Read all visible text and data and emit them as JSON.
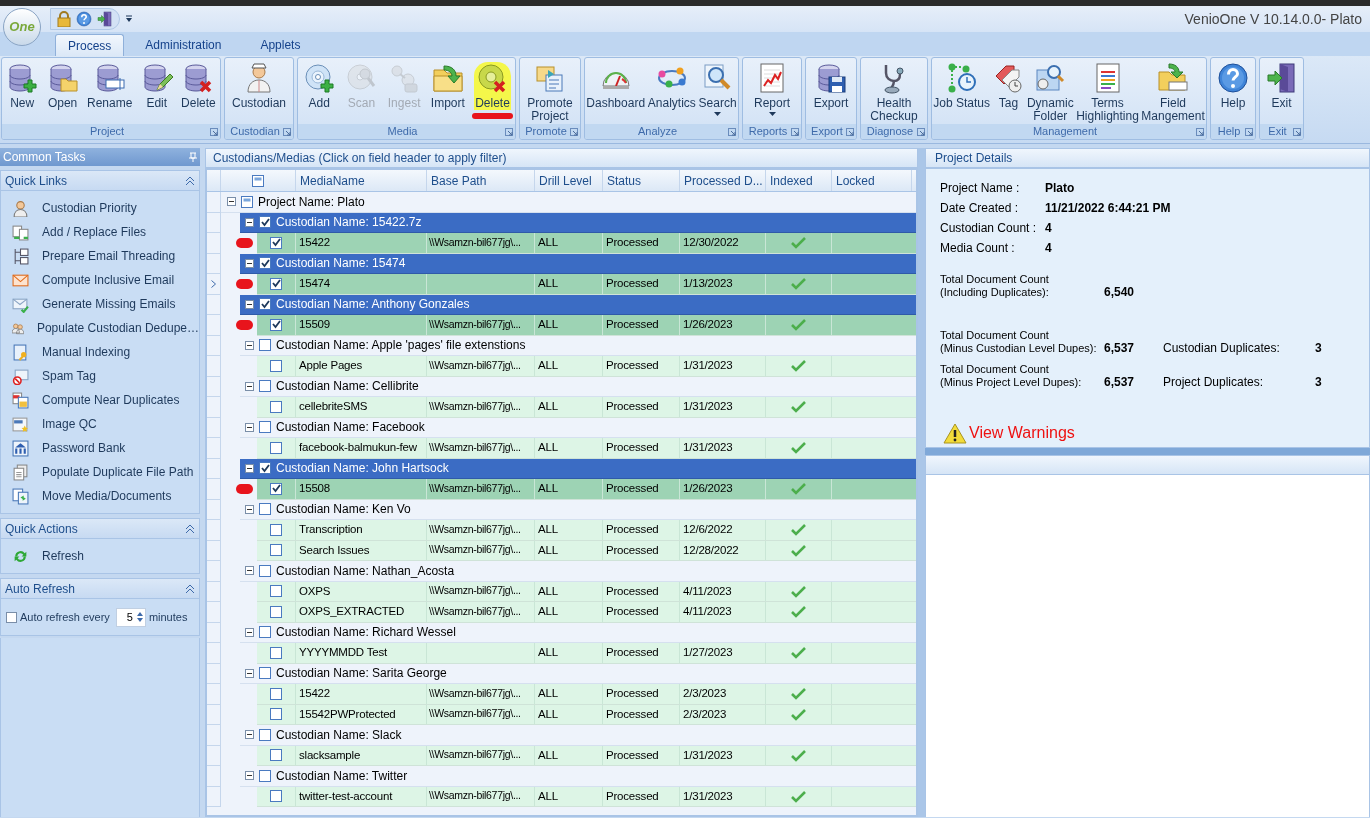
{
  "app": {
    "logo_text": "One",
    "title": "VenioOne V 10.14.0.0- Plato"
  },
  "tabs": [
    {
      "label": "Process",
      "selected": true
    },
    {
      "label": "Administration",
      "selected": false
    },
    {
      "label": "Applets",
      "selected": false
    }
  ],
  "ribbon": [
    {
      "caption": "Project",
      "buttons": [
        {
          "label": "New",
          "disabled": false,
          "dropdown": false,
          "highlighted": false
        },
        {
          "label": "Open",
          "disabled": false,
          "dropdown": false,
          "highlighted": false
        },
        {
          "label": "Rename",
          "disabled": false,
          "dropdown": false,
          "highlighted": false
        },
        {
          "label": "Edit",
          "disabled": false,
          "dropdown": false,
          "highlighted": false
        },
        {
          "label": "Delete",
          "disabled": false,
          "dropdown": false,
          "highlighted": false
        }
      ]
    },
    {
      "caption": "Custodian",
      "buttons": [
        {
          "label": "Custodian",
          "disabled": false,
          "dropdown": false,
          "highlighted": false
        }
      ]
    },
    {
      "caption": "Media",
      "buttons": [
        {
          "label": "Add",
          "disabled": false,
          "dropdown": false,
          "highlighted": false
        },
        {
          "label": "Scan",
          "disabled": true,
          "dropdown": false,
          "highlighted": false
        },
        {
          "label": "Ingest",
          "disabled": true,
          "dropdown": false,
          "highlighted": false
        },
        {
          "label": "Import",
          "disabled": false,
          "dropdown": false,
          "highlighted": false
        },
        {
          "label": "Delete",
          "disabled": false,
          "dropdown": false,
          "highlighted": true
        }
      ]
    },
    {
      "caption": "Promote",
      "buttons": [
        {
          "label": "Promote\nProject",
          "disabled": false,
          "dropdown": false,
          "highlighted": false
        }
      ]
    },
    {
      "caption": "Analyze",
      "buttons": [
        {
          "label": "Dashboard",
          "disabled": false,
          "dropdown": false,
          "highlighted": false
        },
        {
          "label": "Analytics",
          "disabled": false,
          "dropdown": false,
          "highlighted": false
        },
        {
          "label": "Search",
          "disabled": false,
          "dropdown": true,
          "highlighted": false
        }
      ]
    },
    {
      "caption": "Reports",
      "buttons": [
        {
          "label": "Report",
          "disabled": false,
          "dropdown": true,
          "highlighted": false
        }
      ]
    },
    {
      "caption": "Export",
      "buttons": [
        {
          "label": "Export",
          "disabled": false,
          "dropdown": false,
          "highlighted": false
        }
      ]
    },
    {
      "caption": "Diagnose",
      "buttons": [
        {
          "label": "Health\nCheckup",
          "disabled": false,
          "dropdown": false,
          "highlighted": false
        }
      ]
    },
    {
      "caption": "Management",
      "buttons": [
        {
          "label": "Job Status",
          "disabled": false,
          "dropdown": false,
          "highlighted": false
        },
        {
          "label": "Tag",
          "disabled": false,
          "dropdown": false,
          "highlighted": false
        },
        {
          "label": "Dynamic\nFolder",
          "disabled": false,
          "dropdown": false,
          "highlighted": false
        },
        {
          "label": "Terms\nHighlighting",
          "disabled": false,
          "dropdown": false,
          "highlighted": false
        },
        {
          "label": "Field\nMangement",
          "disabled": false,
          "dropdown": false,
          "highlighted": false
        }
      ]
    },
    {
      "caption": "Help",
      "buttons": [
        {
          "label": "Help",
          "disabled": false,
          "dropdown": false,
          "highlighted": false
        }
      ]
    },
    {
      "caption": "Exit",
      "buttons": [
        {
          "label": "Exit",
          "disabled": false,
          "dropdown": false,
          "highlighted": false
        }
      ]
    }
  ],
  "sidebar": {
    "title": "Common Tasks",
    "sections": [
      {
        "title": "Quick Links",
        "expanded": true,
        "items": [
          "Custodian Priority",
          "Add / Replace Files",
          "Prepare Email Threading",
          "Compute Inclusive Email",
          "Generate Missing Emails",
          "Populate Custodian Dedupe…",
          "Manual Indexing",
          "Spam Tag",
          "Compute Near Duplicates",
          "Image QC",
          "Password Bank",
          "Populate Duplicate File Path",
          "Move Media/Documents"
        ]
      },
      {
        "title": "Quick Actions",
        "expanded": true,
        "items": [
          "Refresh"
        ]
      },
      {
        "title": "Auto Refresh",
        "expanded": true,
        "auto_refresh": {
          "checked": false,
          "label": "Auto refresh every",
          "value": "5",
          "unit": "minutes"
        }
      }
    ]
  },
  "grid": {
    "title": "Custodians/Medias (Click on field header to apply filter)",
    "columns": [
      "MediaName",
      "Base Path",
      "Drill Level",
      "Status",
      "Processed D...",
      "Indexed",
      "Locked"
    ],
    "project": {
      "label": "Project Name: Plato",
      "expanded": true,
      "children": [
        {
          "label": "Custodian Name: 15422.7z",
          "checked": true,
          "expanded": true,
          "children": [
            {
              "name": "15422",
              "base_path": "\\\\Wsamzn-bil677jg\\...",
              "drill_level": "ALL",
              "status": "Processed",
              "processed_date": "12/30/2022",
              "indexed": true,
              "checked": true,
              "current": false,
              "annotated": true
            }
          ]
        },
        {
          "label": "Custodian Name: 15474",
          "checked": true,
          "expanded": true,
          "children": [
            {
              "name": "15474",
              "drill_level": "ALL",
              "status": "Processed",
              "processed_date": "1/13/2023",
              "indexed": true,
              "checked": true,
              "current": true,
              "annotated": true
            }
          ]
        },
        {
          "label": "Custodian Name: Anthony Gonzales",
          "checked": true,
          "expanded": true,
          "children": [
            {
              "name": "15509",
              "base_path": "\\\\Wsamzn-bil677jg\\...",
              "drill_level": "ALL",
              "status": "Processed",
              "processed_date": "1/26/2023",
              "indexed": true,
              "checked": true,
              "current": false,
              "annotated": true
            }
          ]
        },
        {
          "label": "Custodian Name: Apple 'pages' file extenstions",
          "checked": false,
          "expanded": true,
          "children": [
            {
              "name": "Apple Pages",
              "base_path": "\\\\Wsamzn-bil677jg\\...",
              "drill_level": "ALL",
              "status": "Processed",
              "processed_date": "1/31/2023",
              "indexed": true,
              "checked": false,
              "current": false,
              "annotated": false
            }
          ]
        },
        {
          "label": "Custodian Name: Cellibrite",
          "checked": false,
          "expanded": true,
          "children": [
            {
              "name": "cellebriteSMS",
              "base_path": "\\\\Wsamzn-bil677jg\\...",
              "drill_level": "ALL",
              "status": "Processed",
              "processed_date": "1/31/2023",
              "indexed": true,
              "checked": false,
              "current": false,
              "annotated": false
            }
          ]
        },
        {
          "label": "Custodian Name: Facebook",
          "checked": false,
          "expanded": true,
          "children": [
            {
              "name": "facebook-balmukun-few",
              "base_path": "\\\\Wsamzn-bil677jg\\...",
              "drill_level": "ALL",
              "status": "Processed",
              "processed_date": "1/31/2023",
              "indexed": true,
              "checked": false,
              "current": false,
              "annotated": false
            }
          ]
        },
        {
          "label": "Custodian Name: John Hartsock",
          "checked": true,
          "expanded": true,
          "children": [
            {
              "name": "15508",
              "base_path": "\\\\Wsamzn-bil677jg\\...",
              "drill_level": "ALL",
              "status": "Processed",
              "processed_date": "1/26/2023",
              "indexed": true,
              "checked": true,
              "current": false,
              "annotated": true
            }
          ]
        },
        {
          "label": "Custodian Name: Ken Vo",
          "checked": false,
          "expanded": true,
          "children": [
            {
              "name": "Transcription",
              "base_path": "\\\\Wsamzn-bil677jg\\...",
              "drill_level": "ALL",
              "status": "Processed",
              "processed_date": "12/6/2022",
              "indexed": true,
              "checked": false,
              "current": false,
              "annotated": false
            },
            {
              "name": "Search Issues",
              "base_path": "\\\\Wsamzn-bil677jg\\...",
              "drill_level": "ALL",
              "status": "Processed",
              "processed_date": "12/28/2022",
              "indexed": true,
              "checked": false,
              "current": false,
              "annotated": false
            }
          ]
        },
        {
          "label": "Custodian Name: Nathan_Acosta",
          "checked": false,
          "expanded": true,
          "children": [
            {
              "name": "OXPS",
              "base_path": "\\\\Wsamzn-bil677jg\\...",
              "drill_level": "ALL",
              "status": "Processed",
              "processed_date": "4/11/2023",
              "indexed": true,
              "checked": false,
              "current": false,
              "annotated": false
            },
            {
              "name": "OXPS_EXTRACTED",
              "base_path": "\\\\Wsamzn-bil677jg\\...",
              "drill_level": "ALL",
              "status": "Processed",
              "processed_date": "4/11/2023",
              "indexed": true,
              "checked": false,
              "current": false,
              "annotated": false
            }
          ]
        },
        {
          "label": "Custodian Name: Richard Wessel",
          "checked": false,
          "expanded": true,
          "children": [
            {
              "name": "YYYYMMDD Test",
              "drill_level": "ALL",
              "status": "Processed",
              "processed_date": "1/27/2023",
              "indexed": true,
              "checked": false,
              "current": false,
              "annotated": false
            }
          ]
        },
        {
          "label": "Custodian Name: Sarita George",
          "checked": false,
          "expanded": true,
          "children": [
            {
              "name": "15422",
              "base_path": "\\\\Wsamzn-bil677jg\\...",
              "drill_level": "ALL",
              "status": "Processed",
              "processed_date": "2/3/2023",
              "indexed": true,
              "checked": false,
              "current": false,
              "annotated": false
            },
            {
              "name": "15542PWProtected",
              "base_path": "\\\\Wsamzn-bil677jg\\...",
              "drill_level": "ALL",
              "status": "Processed",
              "processed_date": "2/3/2023",
              "indexed": true,
              "checked": false,
              "current": false,
              "annotated": false
            }
          ]
        },
        {
          "label": "Custodian Name: Slack",
          "checked": false,
          "expanded": true,
          "children": [
            {
              "name": "slacksample",
              "base_path": "\\\\Wsamzn-bil677jg\\...",
              "drill_level": "ALL",
              "status": "Processed",
              "processed_date": "1/31/2023",
              "indexed": true,
              "checked": false,
              "current": false,
              "annotated": false
            }
          ]
        },
        {
          "label": "Custodian Name: Twitter",
          "checked": false,
          "expanded": true,
          "children": [
            {
              "name": "twitter-test-account",
              "base_path": "\\\\Wsamzn-bil677jg\\...",
              "drill_level": "ALL",
              "status": "Processed",
              "processed_date": "1/31/2023",
              "indexed": true,
              "checked": false,
              "current": false,
              "annotated": false
            }
          ]
        }
      ]
    }
  },
  "details": {
    "title": "Project Details",
    "fields": [
      {
        "label": "Project Name :",
        "value": "Plato"
      },
      {
        "label": "Date Created :",
        "value": "11/21/2022 6:44:21 PM"
      },
      {
        "label": "Custodian Count :",
        "value": "4"
      },
      {
        "label": "Media Count :",
        "value": "4"
      }
    ],
    "counts": [
      {
        "label": "Total Document Count\n(Including Duplicates):",
        "value": "6,540"
      },
      {
        "label": "Total Document Count\n(Minus Custodian Level Dupes):",
        "value": "6,537",
        "extra_label": "Custodian Duplicates:",
        "extra_value": "3"
      },
      {
        "label": "Total Document Count\n(Minus Project Level Dupes):",
        "value": "6,537",
        "extra_label": "Project Duplicates:",
        "extra_value": "3"
      }
    ],
    "warning_link": "View Warnings"
  }
}
